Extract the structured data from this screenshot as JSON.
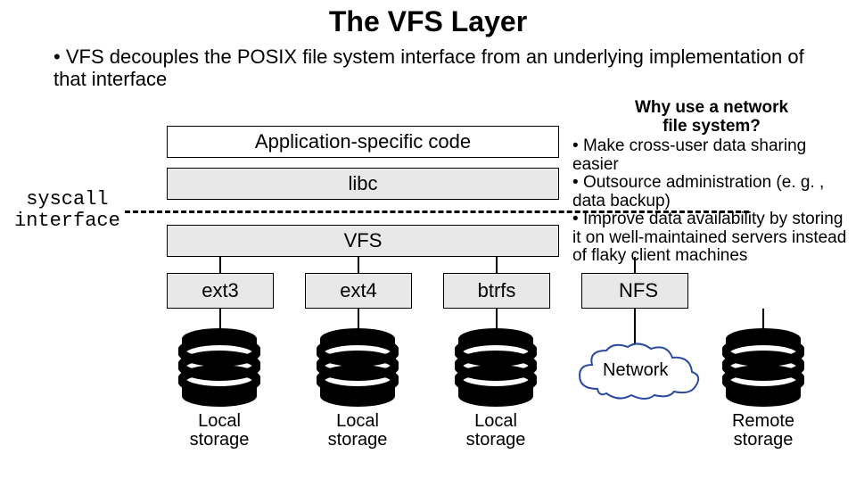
{
  "title": "The VFS Layer",
  "main_bullet": "VFS decouples the POSIX file system interface from an underlying implementation of that interface",
  "syscall_label_l1": "syscall",
  "syscall_label_l2": "interface",
  "boxes": {
    "app": "Application-specific code",
    "libc": "libc",
    "vfs": "VFS",
    "ext3": "ext3",
    "ext4": "ext4",
    "btrfs": "btrfs",
    "nfs": "NFS"
  },
  "side": {
    "heading_l1": "Why use a network",
    "heading_l2": "file system?",
    "items": [
      "Make cross-user data sharing easier",
      "Outsource administration (e. g. , data backup)",
      "Improve data availability by storing it on well-maintained servers instead of flaky client machines"
    ]
  },
  "cloud_label": "Network",
  "storage": {
    "local": "Local\nstorage",
    "remote": "Remote\nstorage"
  }
}
